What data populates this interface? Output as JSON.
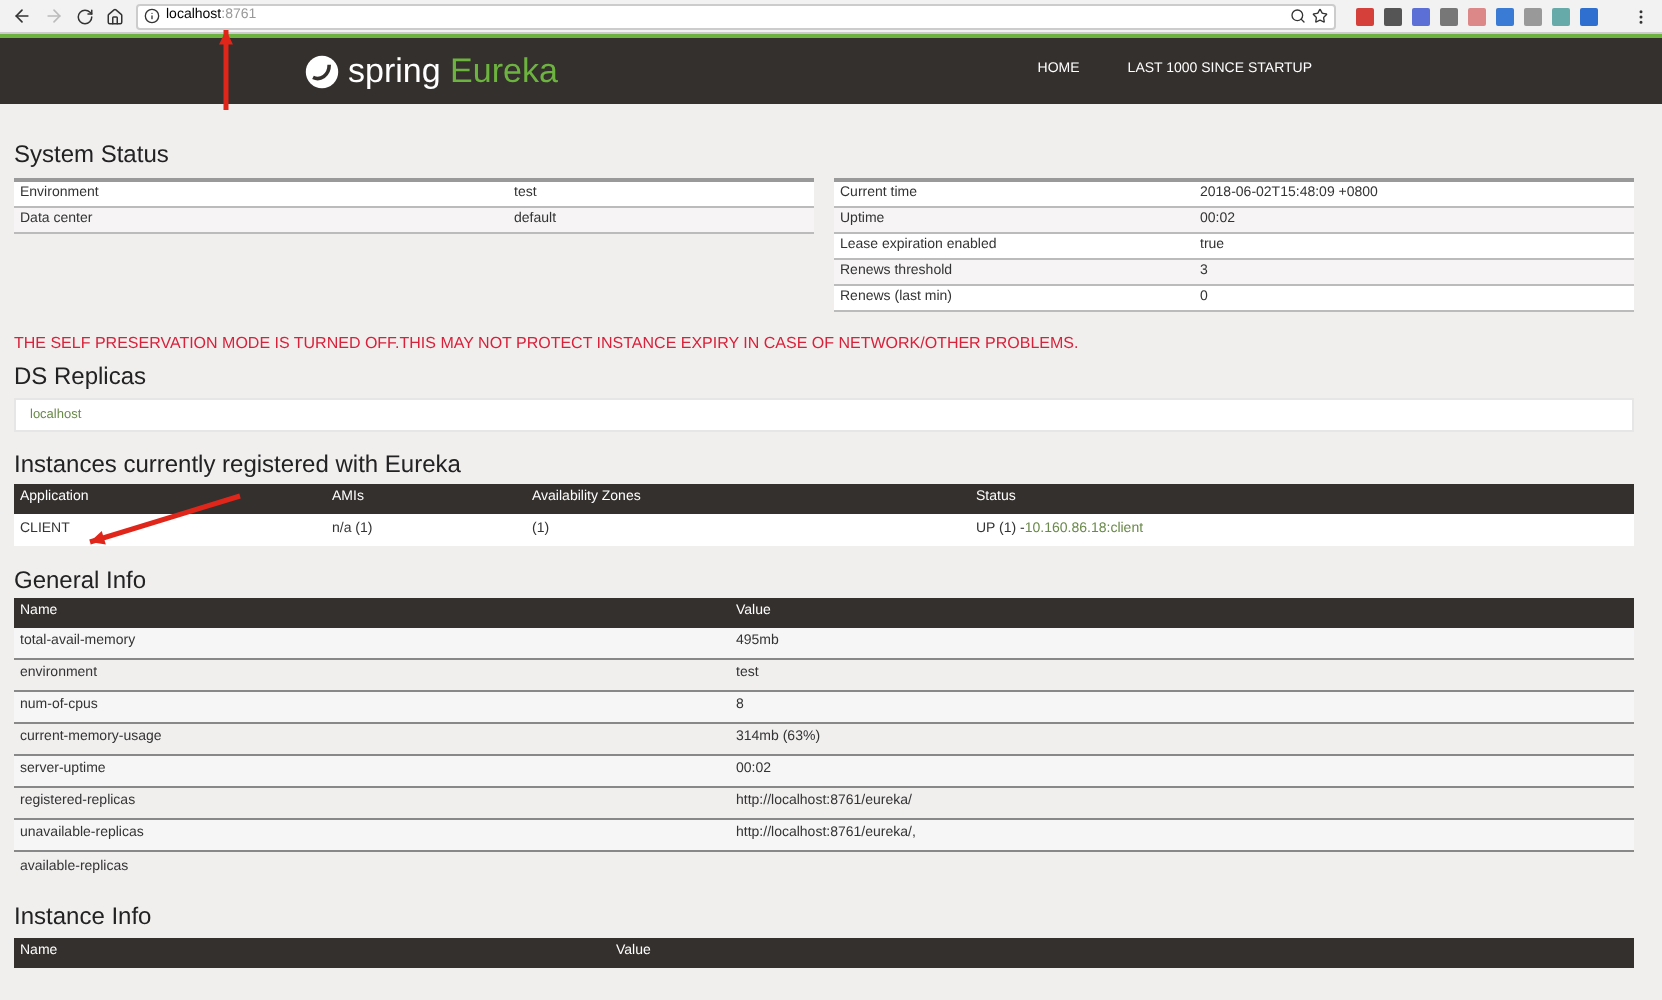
{
  "browser": {
    "url_host": "localhost",
    "url_port": ":8761"
  },
  "nav": {
    "logo_word": "spring",
    "logo_product": "Eureka",
    "links": [
      "HOME",
      "LAST 1000 SINCE STARTUP"
    ]
  },
  "system_status": {
    "title": "System Status",
    "left": [
      {
        "name": "Environment",
        "value": "test"
      },
      {
        "name": "Data center",
        "value": "default"
      }
    ],
    "right": [
      {
        "name": "Current time",
        "value": "2018-06-02T15:48:09 +0800"
      },
      {
        "name": "Uptime",
        "value": "00:02"
      },
      {
        "name": "Lease expiration enabled",
        "value": "true"
      },
      {
        "name": "Renews threshold",
        "value": "3"
      },
      {
        "name": "Renews (last min)",
        "value": "0"
      }
    ]
  },
  "warning": "THE SELF PRESERVATION MODE IS TURNED OFF.THIS MAY NOT PROTECT INSTANCE EXPIRY IN CASE OF NETWORK/OTHER PROBLEMS.",
  "ds_replicas": {
    "title": "DS Replicas",
    "items": [
      "localhost"
    ]
  },
  "instances": {
    "title": "Instances currently registered with Eureka",
    "columns": [
      "Application",
      "AMIs",
      "Availability Zones",
      "Status"
    ],
    "rows": [
      {
        "application": "CLIENT",
        "amis": "n/a (1)",
        "zones": "(1)",
        "status": "UP (1) - ",
        "instance_link": "10.160.86.18:client"
      }
    ]
  },
  "general_info": {
    "title": "General Info",
    "columns": [
      "Name",
      "Value"
    ],
    "rows": [
      {
        "name": "total-avail-memory",
        "value": "495mb"
      },
      {
        "name": "environment",
        "value": "test"
      },
      {
        "name": "num-of-cpus",
        "value": "8"
      },
      {
        "name": "current-memory-usage",
        "value": "314mb (63%)"
      },
      {
        "name": "server-uptime",
        "value": "00:02"
      },
      {
        "name": "registered-replicas",
        "value": "http://localhost:8761/eureka/"
      },
      {
        "name": "unavailable-replicas",
        "value": "http://localhost:8761/eureka/,"
      },
      {
        "name": "available-replicas",
        "value": ""
      }
    ]
  },
  "instance_info": {
    "title": "Instance Info",
    "columns": [
      "Name",
      "Value"
    ]
  }
}
